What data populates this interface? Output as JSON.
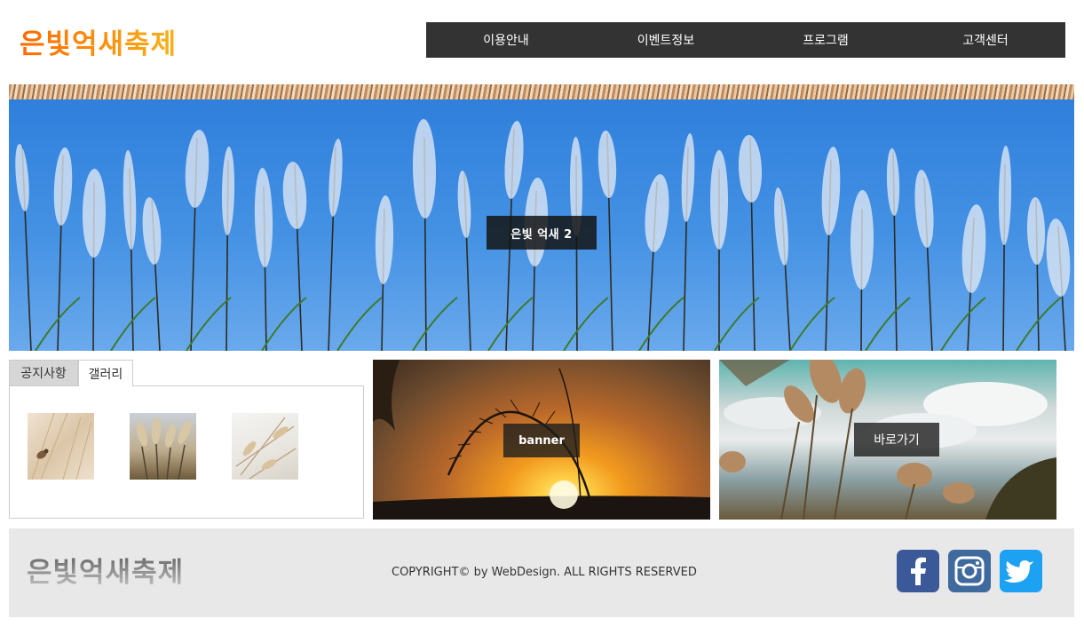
{
  "header": {
    "logo": "은빛억새축제",
    "nav": [
      "이용안내",
      "이벤트정보",
      "프로그램",
      "고객센터"
    ]
  },
  "hero": {
    "caption": "은빛 억새 2"
  },
  "tabs": {
    "notice_label": "공지사항",
    "gallery_label": "갤러리",
    "active": "갤러리"
  },
  "banners": {
    "banner_label": "banner",
    "shortcut_label": "바로가기"
  },
  "footer": {
    "logo": "은빛억새축제",
    "copyright": "COPYRIGHT© by WebDesign. ALL RIGHTS RESERVED"
  },
  "colors": {
    "nav_bg": "#333333",
    "logo_gradient": [
      "#ff6a00",
      "#f7b21a"
    ],
    "footer_bg": "#e8e8e8",
    "facebook": "#3b5998",
    "instagram": "#3f6a9e",
    "twitter": "#1da1f2"
  },
  "icons": [
    "facebook-icon",
    "instagram-icon",
    "twitter-icon"
  ]
}
